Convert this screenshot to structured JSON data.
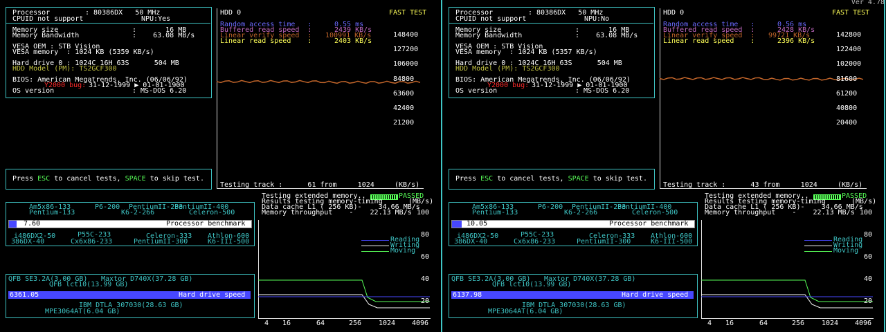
{
  "version": "Ver 4.78",
  "colors": {
    "cyan": "#3fc6c6",
    "blue": "#4747ff",
    "orange": "#c2652a",
    "magenta": "#c26ac2",
    "yellow": "#ffff58",
    "green": "#58ff58",
    "red": "#ff2a2a"
  },
  "panels": [
    {
      "processor_label": "Processor",
      "processor_value": ": 80386DX   50 MHz",
      "cpuid": "CPUID not support",
      "npu": "NPU:Yes",
      "mem_size_label": "Memory size",
      "mem_size_value": ":       16 MB",
      "mem_bw_label": "Memory Bandwidth",
      "mem_bw_value": ":    63.08 MB/s",
      "vesa_oem": "VESA OEM : STB Vision",
      "vesa_mem": "VESA memory  : 1024 KB (5359 KB/s)",
      "hdd": "Hard drive 0 : 1024C 16H 63S      504 MB",
      "hdd_model": "HDD Model (PM): TS2GCF300",
      "bios": "BIOS: American Megatrends, Inc. (06/06/92)",
      "y2k_label": "Y2000 bug:",
      "y2k_value": "31-12-1999 ▶ 01-01-1900",
      "os_label": "OS version",
      "os_value": ": MS-DOS 6.20",
      "esc_text": "Press ESC to cancel tests, SPACE to skip test.",
      "esc": "ESC",
      "space": "SPACE",
      "hdd_title": "HDD 0",
      "fast_test": "FAST TEST",
      "random_label": "Random access time   :",
      "random_value": "0.55 ms",
      "buffered_label": "Buffered read speed  :",
      "buffered_value": "2439 KB/s",
      "linear_verify_label": "Linear verify speed  :",
      "linear_verify_value": "100991 KB/s",
      "linear_read_label": "Linear read speed    :",
      "linear_read_value": "2403 KB/s",
      "testing_track": "Testing track :      61 from     1024",
      "kbs": "(KB/s)",
      "y_ticks": [
        "148400",
        "127200",
        "106000",
        "84800",
        "63600",
        "42400",
        "21200"
      ],
      "hdd_level": 100500,
      "ext_mem": "Testing extended memory..",
      "passed": "PASSED",
      "results_timing": "Results testing memory-timing",
      "mbs": "(MB/s)",
      "data_cache": "Data cache L1 ( 256 KB)-    34.66 MB/s",
      "mem_throughput": "Memory throughput    -    22.13 MB/s",
      "bench_value": "7.60",
      "bench_fill": 0.03,
      "bench_label": "Processor benchmark",
      "cpu_top": [
        "Am5x86-133",
        "P6-200",
        "PentiumII-233",
        "PentiumII-400",
        "Pentium-133",
        "K6-2-266",
        "Celeron-500"
      ],
      "cpu_bottom": [
        "i486DX2-50",
        "P55C-233",
        "Celeron-333",
        "Athlon-600",
        "386DX-40",
        "Cx6x86-233",
        "PentiumII-300",
        "K6-III-500"
      ],
      "hdd_top": [
        "QFB SE3.2A(3.00 GB)",
        "Maxtor D740X(37.28 GB)",
        "QFB lct10(13.99 GB)"
      ],
      "hdd_bottom": [
        "IBM DTLA 307030(28.63 GB)",
        "MPE3064AT(6.04 GB)"
      ],
      "hd_value": "6361.05",
      "hd_label": "Hard drive speed",
      "legend": [
        "Reading",
        "Writing",
        "Moving"
      ],
      "mem_y_ticks": [
        "100",
        "80",
        "60",
        "40",
        "20"
      ],
      "mem_x_ticks": [
        "4",
        "16",
        "64",
        "256",
        "1024",
        "4096"
      ]
    },
    {
      "processor_label": "Processor",
      "processor_value": ": 80386DX   50 MHz",
      "cpuid": "CPUID not support",
      "npu": "NPU:No",
      "mem_size_label": "Memory size",
      "mem_size_value": ":       16 MB",
      "mem_bw_label": "Memory Bandwidth",
      "mem_bw_value": ":    63.08 MB/s",
      "vesa_oem": "VESA OEM : STB Vision",
      "vesa_mem": "VESA memory  : 1024 KB (5357 KB/s)",
      "hdd": "Hard drive 0 : 1024C 16H 63S      504 MB",
      "hdd_model": "HDD Model (PM): TS2GCF300",
      "bios": "BIOS: American Megatrends, Inc. (06/06/92)",
      "y2k_label": "Y2000 bug:",
      "y2k_value": "31-12-1999 ▶ 01-01-1900",
      "os_label": "OS version",
      "os_value": ": MS-DOS 6.20",
      "esc_text": "Press ESC to cancel tests, SPACE to skip test.",
      "esc": "ESC",
      "space": "SPACE",
      "hdd_title": "HDD 0",
      "fast_test": "FAST TEST",
      "random_label": "Random access time   :",
      "random_value": "0.56 ms",
      "buffered_label": "Buffered read speed  :",
      "buffered_value": "2428 KB/s",
      "linear_verify_label": "Linear verify speed  :",
      "linear_verify_value": "99721 KB/s",
      "linear_read_label": "Linear read speed    :",
      "linear_read_value": "2396 KB/s",
      "testing_track": "Testing track :      43 from     1024",
      "kbs": "(KB/s)",
      "y_ticks": [
        "142800",
        "122400",
        "102000",
        "81600",
        "61200",
        "40800",
        "20400"
      ],
      "hdd_level": 99500,
      "ext_mem": "Testing extended memory..",
      "passed": "PASSED",
      "results_timing": "Results testing memory-timing",
      "mbs": "(MB/s)",
      "data_cache": "Data cache L1 ( 256 KB)-    34.66 MB/s",
      "mem_throughput": "Memory throughput    -    22.13 MB/s",
      "bench_value": "10.05",
      "bench_fill": 0.04,
      "bench_label": "Processor benchmark",
      "cpu_top": [
        "Am5x86-133",
        "P6-200",
        "PentiumII-233",
        "PentiumII-400",
        "Pentium-133",
        "K6-2-266",
        "Celeron-500"
      ],
      "cpu_bottom": [
        "i486DX2-50",
        "P55C-233",
        "Celeron-333",
        "Athlon-600",
        "386DX-40",
        "Cx6x86-233",
        "PentiumII-300",
        "K6-III-500"
      ],
      "hdd_top": [
        "QFB SE3.2A(3.00 GB)",
        "Maxtor D740X(37.28 GB)",
        "QFB lct10(13.99 GB)"
      ],
      "hdd_bottom": [
        "IBM DTLA 307030(28.63 GB)",
        "MPE3064AT(6.04 GB)"
      ],
      "hd_value": "6137.98",
      "hd_label": "Hard drive speed",
      "legend": [
        "Reading",
        "Writing",
        "Moving"
      ],
      "mem_y_ticks": [
        "100",
        "80",
        "60",
        "40",
        "20"
      ],
      "mem_x_ticks": [
        "4",
        "16",
        "64",
        "256",
        "1024",
        "4096"
      ]
    }
  ]
}
